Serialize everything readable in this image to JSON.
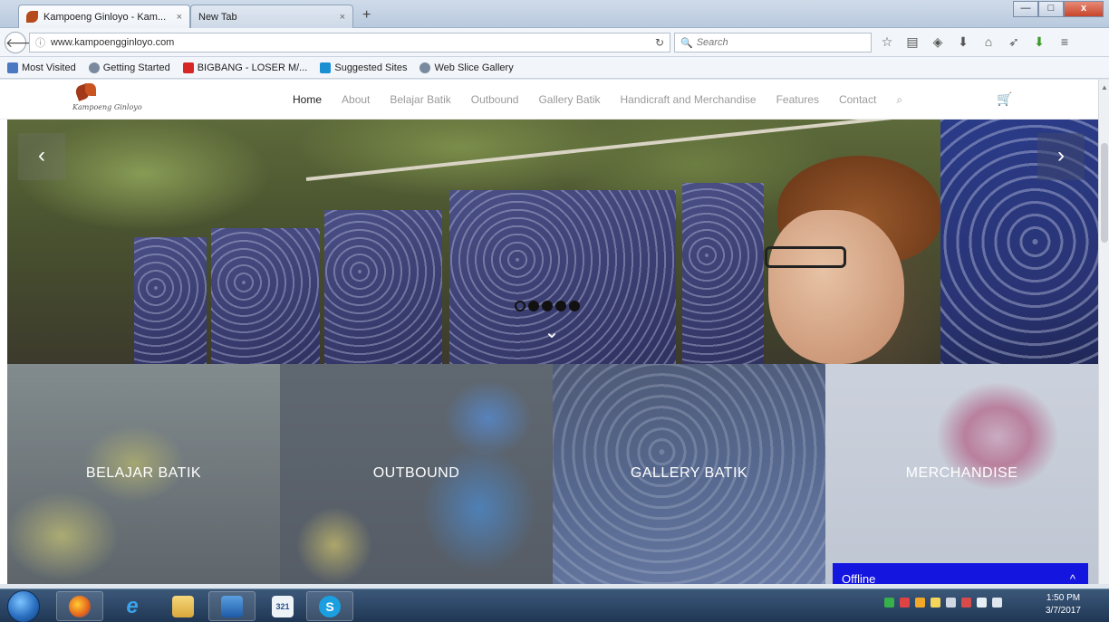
{
  "browser": {
    "tabs": [
      {
        "title": "Kampoeng Ginloyo - Kam...",
        "active": true
      },
      {
        "title": "New Tab",
        "active": false
      }
    ],
    "new_tab_symbol": "+",
    "close_symbol": "×",
    "window_buttons": {
      "minimize": "—",
      "maximize": "□",
      "close": "x"
    },
    "url": "www.kampoengginloyo.com",
    "search_placeholder": "Search",
    "bookmarks": [
      {
        "label": "Most Visited",
        "icon": "bookmark-icon"
      },
      {
        "label": "Getting Started",
        "icon": "globe-icon"
      },
      {
        "label": "BIGBANG - LOSER M/...",
        "icon": "youtube-icon"
      },
      {
        "label": "Suggested Sites",
        "icon": "bing-icon"
      },
      {
        "label": "Web Slice Gallery",
        "icon": "globe-icon"
      }
    ]
  },
  "site": {
    "logo_text": "Kampoeng Ginloyo",
    "nav": [
      {
        "label": "Home",
        "active": true
      },
      {
        "label": "About",
        "active": false
      },
      {
        "label": "Belajar Batik",
        "active": false
      },
      {
        "label": "Outbound",
        "active": false
      },
      {
        "label": "Gallery Batik",
        "active": false
      },
      {
        "label": "Handicraft and Merchandise",
        "active": false
      },
      {
        "label": "Features",
        "active": false
      },
      {
        "label": "Contact",
        "active": false
      }
    ],
    "hero": {
      "slide_count": 5,
      "active_slide": 1,
      "prev_symbol": "‹",
      "next_symbol": "›",
      "scroll_symbol": "⌄"
    },
    "tiles": [
      {
        "label": "BELAJAR BATIK"
      },
      {
        "label": "OUTBOUND"
      },
      {
        "label": "GALLERY BATIK"
      },
      {
        "label": "MERCHANDISE"
      }
    ],
    "chat": {
      "status": "Offline",
      "toggle_symbol": "^"
    }
  },
  "taskbar": {
    "apps": [
      "firefox-icon",
      "internet-explorer-icon",
      "file-explorer-icon",
      "media-player-icon",
      "calendar-icon",
      "skype-icon"
    ],
    "time": "1:50 PM",
    "date": "3/7/2017"
  },
  "colors": {
    "chat_bg": "#1515e0",
    "nav_active": "#222222",
    "nav_inactive": "#9a9a9a"
  }
}
